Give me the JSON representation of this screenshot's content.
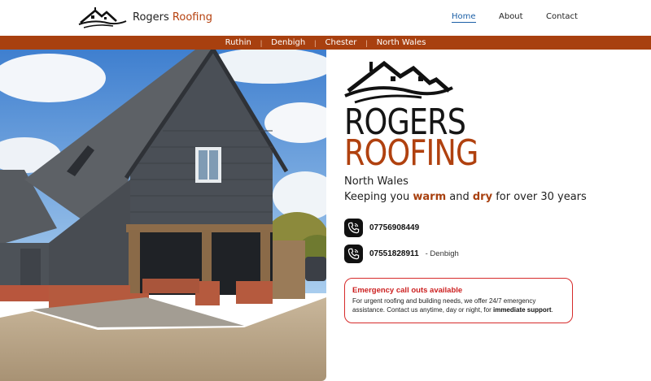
{
  "brand": {
    "word1": "Rogers",
    "word2": "Roofing",
    "accent_color": "#b5400e"
  },
  "nav": {
    "items": [
      {
        "label": "Home",
        "active": true
      },
      {
        "label": "About",
        "active": false
      },
      {
        "label": "Contact",
        "active": false
      }
    ]
  },
  "locations": [
    "Ruthin",
    "Denbigh",
    "Chester",
    "North Wales"
  ],
  "locations_separator": "|",
  "hero": {
    "title_line1": "ROGERS",
    "title_line2": "ROOFING",
    "region": "North Wales",
    "tagline_prefix": "Keeping you ",
    "tagline_warm": "warm",
    "tagline_and": " and ",
    "tagline_dry": "dry",
    "tagline_suffix": " for over 30 years"
  },
  "phones": [
    {
      "number": "07756908449",
      "note": "",
      "icon": "phone-icon"
    },
    {
      "number": "07551828911",
      "note": "- Denbigh",
      "icon": "phone-icon"
    }
  ],
  "alert": {
    "title": "Emergency call outs available",
    "body_prefix": "For urgent roofing and building needs, we offer 24/7 emergency assistance. Contact us anytime, day or night, for ",
    "body_bold": "immediate support",
    "body_suffix": ".",
    "border_color": "#d62b2b"
  },
  "colors": {
    "strip": "#a8400f",
    "nav_active": "#1b5fa6"
  }
}
